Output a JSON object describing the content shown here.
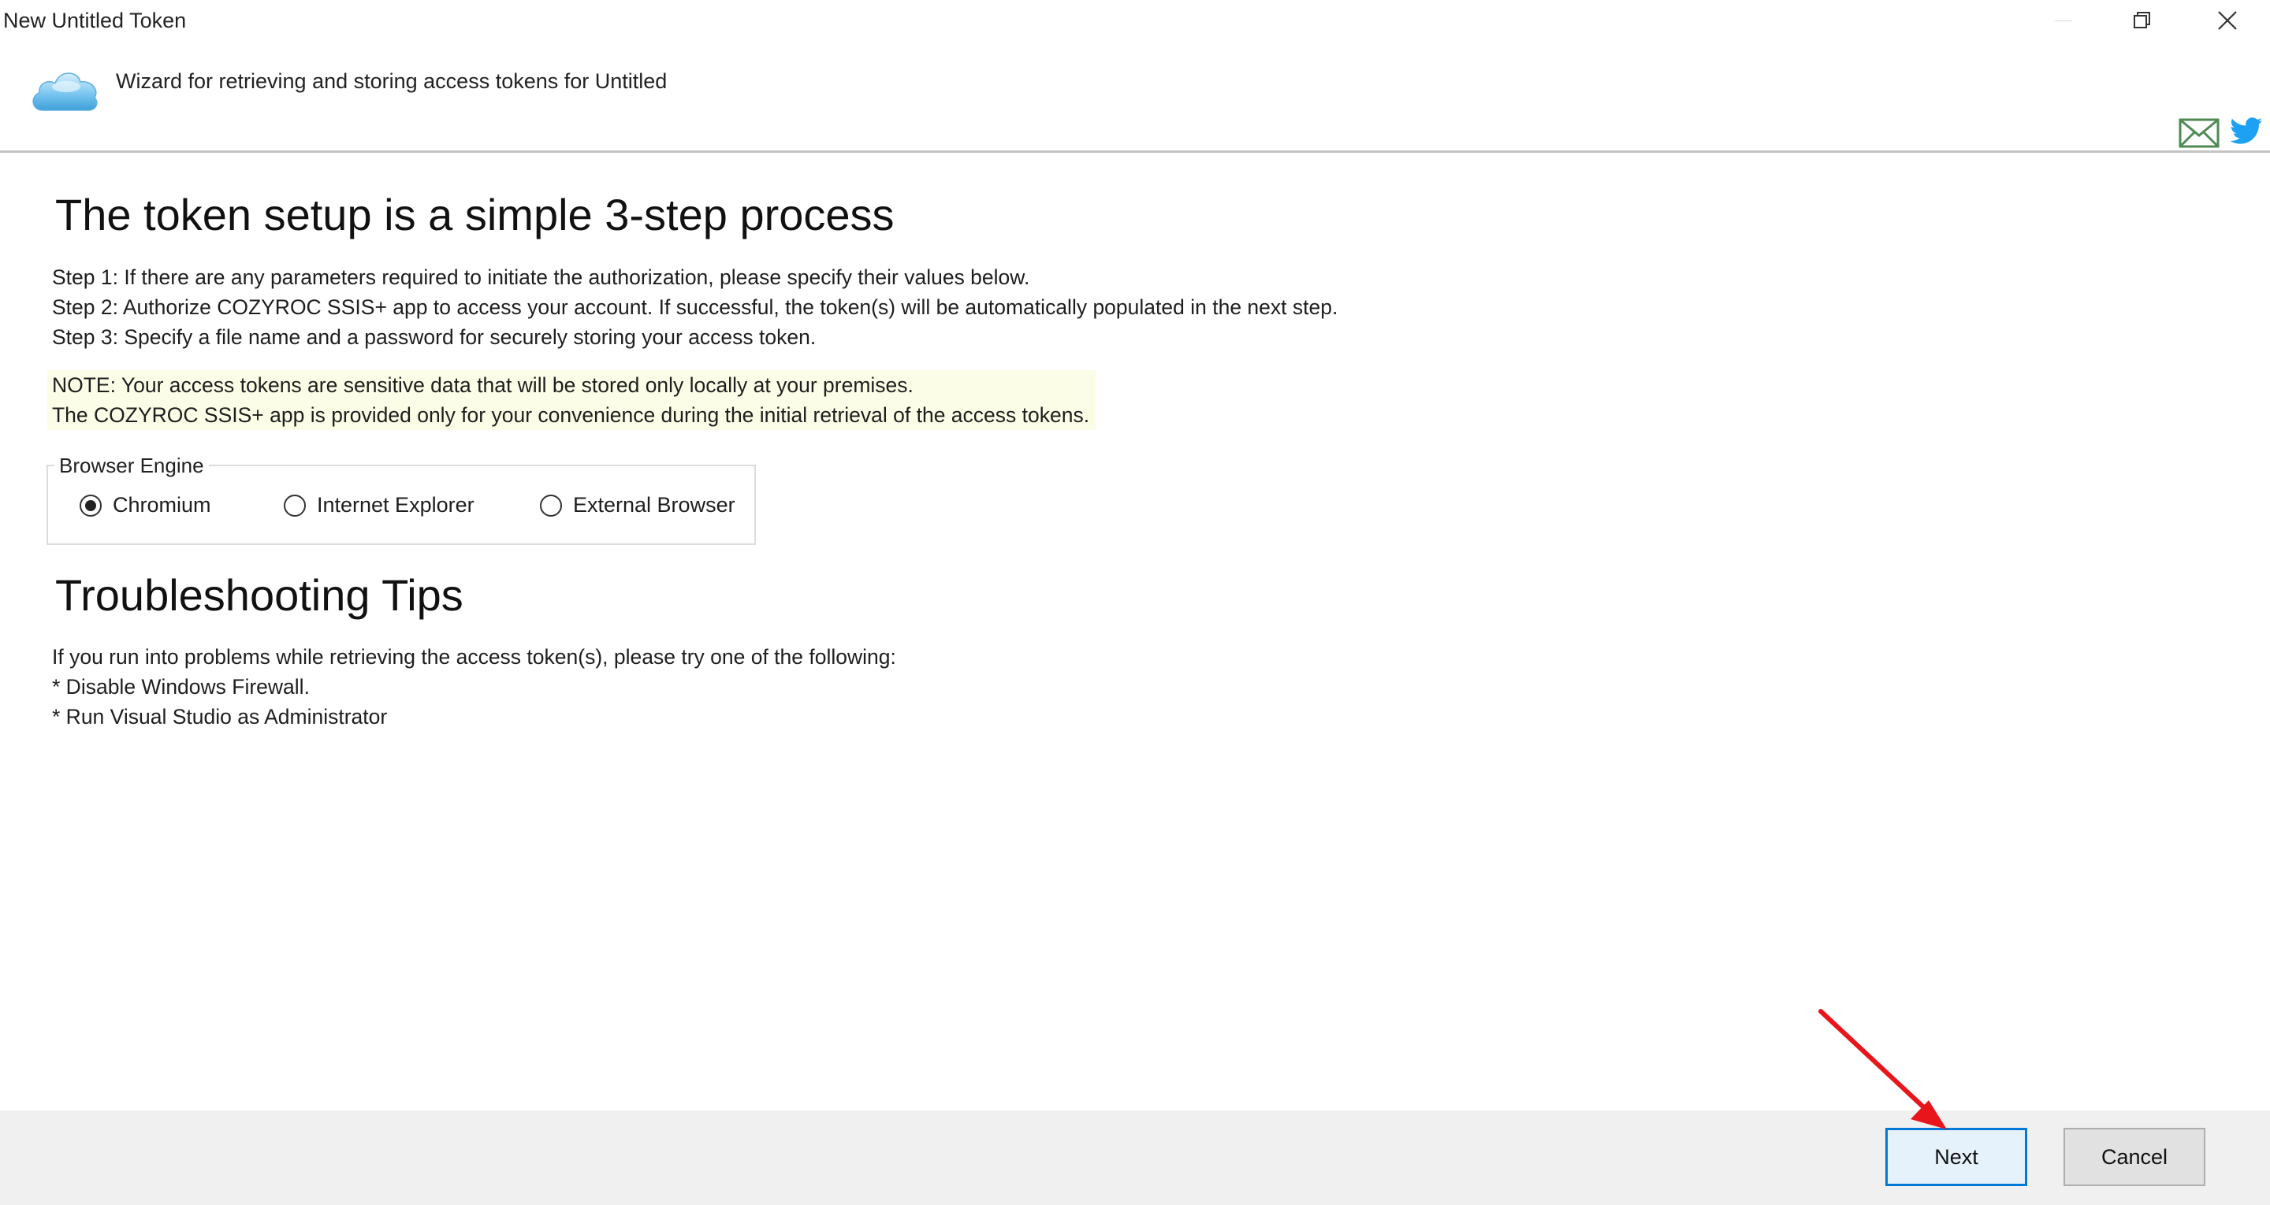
{
  "window": {
    "title": "New Untitled Token"
  },
  "header": {
    "subtitle": "Wizard for retrieving and storing access tokens for Untitled"
  },
  "main": {
    "heading": "The token setup is a simple 3-step process",
    "steps": [
      "Step 1: If there are any parameters required to initiate the authorization, please specify their values below.",
      "Step 2: Authorize COZYROC SSIS+ app to access your account. If successful, the token(s) will be automatically populated in the next step.",
      "Step 3: Specify a file name and a password for securely storing your access token."
    ],
    "note": [
      "NOTE: Your access tokens are sensitive data that will be stored only locally at your premises.",
      "The COZYROC SSIS+ app is provided only for your convenience during the initial retrieval of the access tokens."
    ],
    "browser_engine": {
      "legend": "Browser Engine",
      "options": [
        "Chromium",
        "Internet Explorer",
        "External Browser"
      ],
      "selected": "Chromium"
    },
    "troubleshooting": {
      "heading": "Troubleshooting Tips",
      "lines": [
        "If you run into problems while retrieving the access token(s), please try one of the following:",
        "* Disable Windows Firewall.",
        "* Run Visual Studio as Administrator"
      ]
    }
  },
  "footer": {
    "next_label": "Next",
    "cancel_label": "Cancel"
  },
  "colors": {
    "accent": "#0078d7",
    "note_bg": "#fbfde6",
    "footer_bg": "#f0f0f0",
    "annotation_arrow": "#e8161b"
  },
  "icons": [
    "cloud-icon",
    "minimize-icon",
    "restore-icon",
    "close-icon",
    "mail-icon",
    "twitter-icon",
    "annotation-arrow"
  ]
}
